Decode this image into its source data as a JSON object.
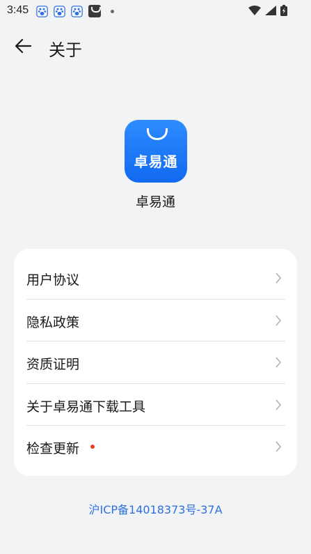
{
  "status_bar": {
    "time": "3:45"
  },
  "header": {
    "title": "关于"
  },
  "app": {
    "logo_text": "卓易通",
    "name": "卓易通"
  },
  "menu": {
    "items": [
      {
        "label": "用户协议"
      },
      {
        "label": "隐私政策"
      },
      {
        "label": "资质证明"
      },
      {
        "label": "关于卓易通下载工具"
      },
      {
        "label": "检查更新",
        "has_badge": true
      }
    ]
  },
  "footer": {
    "icp": "沪ICP备14018373号-37A"
  },
  "colors": {
    "background": "#f1f3f5",
    "logo_blue": "#1169f0",
    "link_blue": "#2f6fe0",
    "badge_red": "#e84026"
  }
}
